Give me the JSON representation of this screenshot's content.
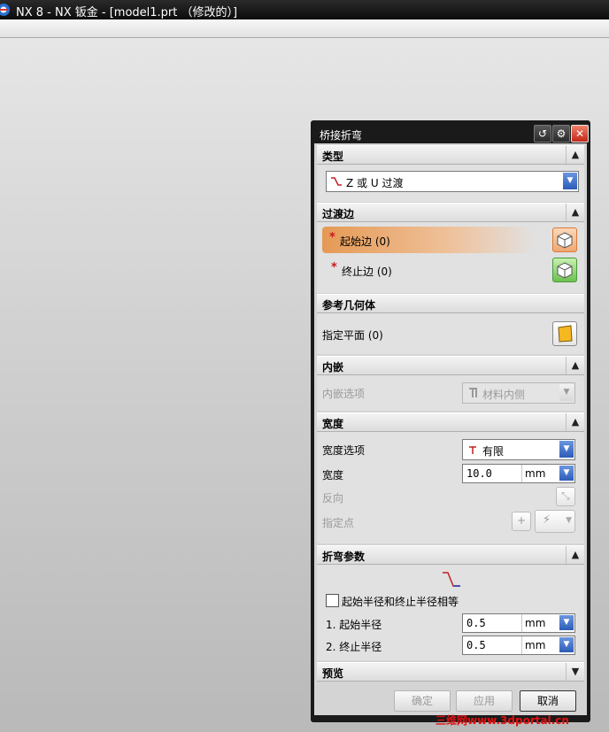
{
  "window": {
    "title": "NX 8 - NX 钣金 - [model1.prt （修改的）]"
  },
  "dialog": {
    "title": "桥接折弯",
    "title_buttons": {
      "reset": "↺",
      "settings": "⚙",
      "close": "✕"
    },
    "sections": {
      "type": {
        "header": "类型",
        "value": "Z 或 U 过渡"
      },
      "transition_edges": {
        "header": "过渡边",
        "start_edge": "起始边 (0)",
        "end_edge": "终止边 (0)"
      },
      "reference_geometry": {
        "header": "参考几何体",
        "specify_plane": "指定平面 (0)"
      },
      "inset": {
        "header": "内嵌",
        "option_label": "内嵌选项",
        "option_value": "材料内侧"
      },
      "width": {
        "header": "宽度",
        "option_label": "宽度选项",
        "option_value": "有限",
        "width_label": "宽度",
        "width_value": "10.0",
        "width_unit": "mm",
        "reverse_label": "反向",
        "point_label": "指定点"
      },
      "bend_params": {
        "header": "折弯参数",
        "equal_radius_label": "起始半径和终止半径相等",
        "equal_radius_checked": false,
        "start_radius_label": "1. 起始半径",
        "start_radius_value": "0.5",
        "start_radius_unit": "mm",
        "end_radius_label": "2. 终止半径",
        "end_radius_value": "0.5",
        "end_radius_unit": "mm"
      },
      "preview": {
        "header": "预览"
      }
    },
    "buttons": {
      "ok": "确定",
      "apply": "应用",
      "cancel": "取消"
    }
  },
  "watermark": "三维网www.3dportal.cn",
  "colors": {
    "accent_orange": "#e59a55",
    "dropdown_blue": "#2c5cb8",
    "required_red": "#c81818"
  }
}
